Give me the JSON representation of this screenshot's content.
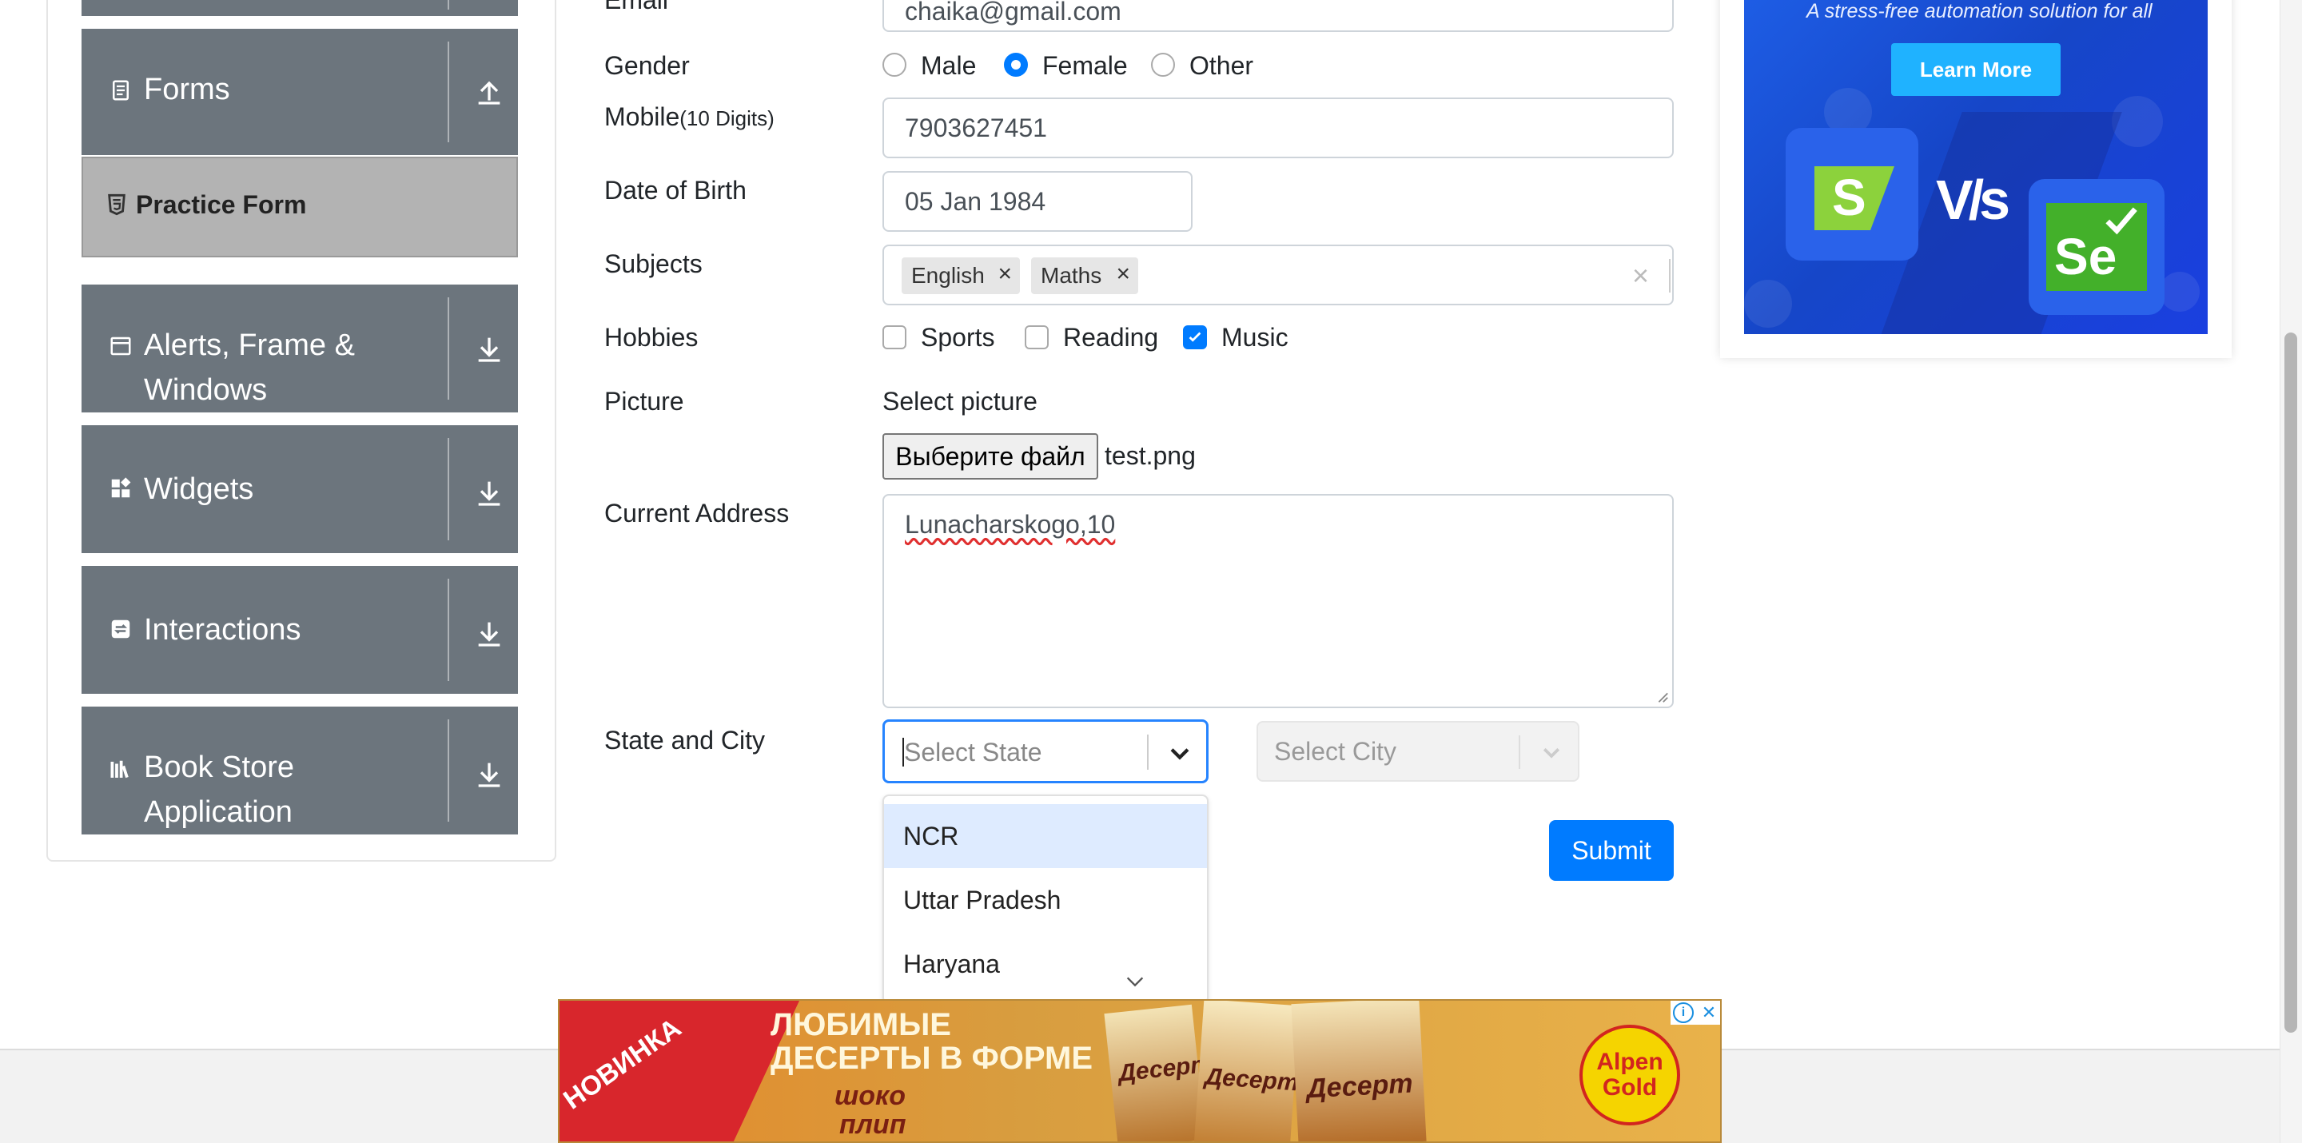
{
  "sidebar": {
    "forms": {
      "label": "Forms"
    },
    "practice_form": {
      "label": "Practice Form"
    },
    "alerts": {
      "line1": "Alerts, Frame &",
      "line2": "Windows"
    },
    "widgets": {
      "label": "Widgets"
    },
    "interactions": {
      "label": "Interactions"
    },
    "book_store": {
      "line1": "Book Store",
      "line2": "Application"
    }
  },
  "form": {
    "email": {
      "label": "Email",
      "value": "chaika@gmail.com"
    },
    "gender": {
      "label": "Gender",
      "options": [
        "Male",
        "Female",
        "Other"
      ],
      "selected": "Female"
    },
    "mobile": {
      "label": "Mobile",
      "hint": "(10 Digits)",
      "value": "7903627451"
    },
    "dob": {
      "label": "Date of Birth",
      "value": "05 Jan 1984"
    },
    "subjects": {
      "label": "Subjects",
      "tags": [
        "English",
        "Maths"
      ],
      "remove_glyph": "×",
      "clear_glyph": "×"
    },
    "hobbies": {
      "label": "Hobbies",
      "options": [
        "Sports",
        "Reading",
        "Music"
      ],
      "checked": [
        "Music"
      ]
    },
    "picture": {
      "label": "Picture",
      "title": "Select picture",
      "button": "Выберите файл",
      "file": "test.png"
    },
    "address": {
      "label": "Current Address",
      "value": "Lunacharskogo,10"
    },
    "state_city": {
      "label": "State and City",
      "state_placeholder": "Select State",
      "city_placeholder": "Select City",
      "state_options": [
        "NCR",
        "Uttar Pradesh",
        "Haryana"
      ],
      "highlighted": "NCR"
    },
    "submit": "Submit"
  },
  "ads": {
    "right": {
      "tagline": "A stress-free automation solution for all",
      "button": "Learn More",
      "vs": "V/s",
      "left_logo": "S",
      "right_logo": "Se"
    },
    "bottom": {
      "badge": "НОВИНКА",
      "headline1": "ЛЮБИМЫЕ",
      "headline2": "ДЕСЕРТЫ В ФОРМЕ",
      "script1": "шоко",
      "script2": "плип",
      "brand1": "Alpen",
      "brand2": "Gold",
      "pack_label": "Десерт",
      "info_glyph": "i",
      "close_glyph": "✕"
    }
  },
  "colors": {
    "sidebar_group": "#6c757d",
    "active_item": "#b3b3b3",
    "primary": "#007bff",
    "focus_border": "#2684ff",
    "option_highlight": "#deebff"
  }
}
